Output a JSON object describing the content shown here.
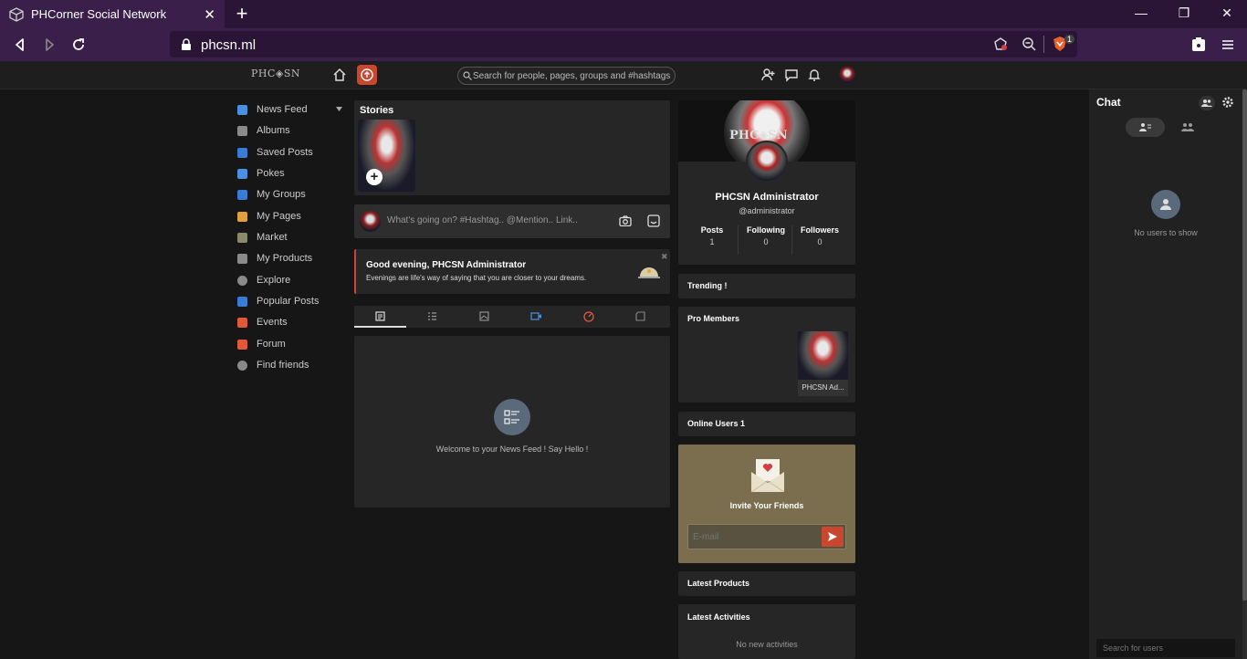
{
  "browser": {
    "tab_title": "PHCorner Social Network",
    "tab_close": "✕",
    "new_tab": "+",
    "url": "phcsn.ml",
    "win_min": "—",
    "win_restore": "❐",
    "win_close": "✕",
    "shield_badge": "1"
  },
  "header": {
    "logo": "PHC◈SN",
    "search_placeholder": "Search for people, pages, groups and #hashtags"
  },
  "sidebar": {
    "items": [
      {
        "label": "News Feed",
        "color": "#4a90e2"
      },
      {
        "label": "Albums",
        "color": "#8a8a8a"
      },
      {
        "label": "Saved Posts",
        "color": "#3a7bd5"
      },
      {
        "label": "Pokes",
        "color": "#4a90e2"
      },
      {
        "label": "My Groups",
        "color": "#3a7bd5"
      },
      {
        "label": "My Pages",
        "color": "#e0a040"
      },
      {
        "label": "Market",
        "color": "#8a8a6a"
      },
      {
        "label": "My Products",
        "color": "#8a8a8a"
      },
      {
        "label": "Explore",
        "color": "#8a8a8a"
      },
      {
        "label": "Popular Posts",
        "color": "#3a7bd5"
      },
      {
        "label": "Events",
        "color": "#e05a3a"
      },
      {
        "label": "Forum",
        "color": "#e05a3a"
      },
      {
        "label": "Find friends",
        "color": "#8a8a8a"
      }
    ]
  },
  "stories": {
    "title": "Stories",
    "add_label": "+"
  },
  "composer": {
    "placeholder": "What's going on? #Hashtag.. @Mention.. Link.."
  },
  "greeting": {
    "title": "Good evening, PHCSN Administrator",
    "subtitle": "Evenings are life's way of saying that you are closer to your dreams.",
    "close": "✖"
  },
  "feed": {
    "empty_text": "Welcome to your News Feed ! Say Hello !"
  },
  "profile": {
    "cover_text": "PHC◈SN",
    "name": "PHCSN Administrator",
    "handle": "@administrator",
    "stats": [
      {
        "label": "Posts",
        "value": "1"
      },
      {
        "label": "Following",
        "value": "0"
      },
      {
        "label": "Followers",
        "value": "0"
      }
    ]
  },
  "trending": {
    "title": "Trending !"
  },
  "pro_members": {
    "title": "Pro Members",
    "member_name": "PHCSN Ad..."
  },
  "online_users": {
    "title": "Online Users 1"
  },
  "invite": {
    "title": "Invite Your Friends",
    "placeholder": "E-mail",
    "bg": "#7a6e4e",
    "send_color": "#c8472e"
  },
  "latest_products": {
    "title": "Latest Products"
  },
  "latest_activities": {
    "title": "Latest Activities",
    "empty": "No new activities"
  },
  "chat": {
    "title": "Chat",
    "empty": "No users to show",
    "search_placeholder": "Search for users"
  }
}
